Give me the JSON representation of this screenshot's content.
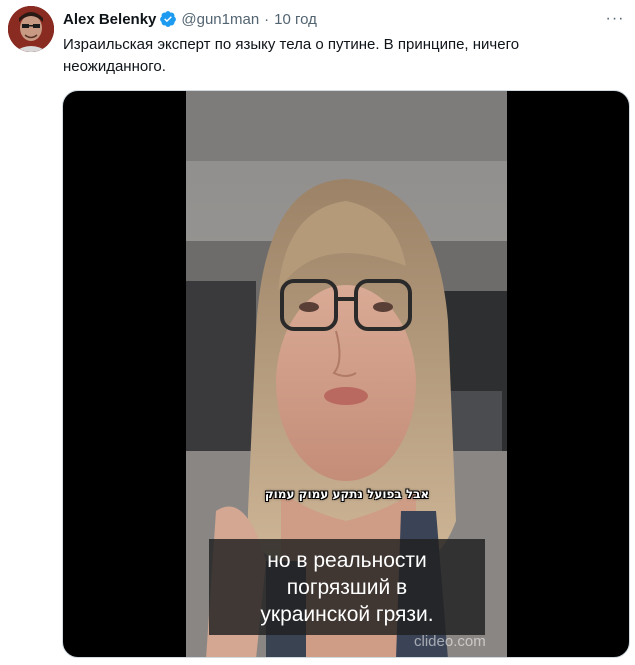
{
  "author": {
    "name": "Alex Belenky",
    "handle": "@gun1man",
    "separator": "·",
    "time": "10 год",
    "avatar_icon": "avatar-portrait",
    "verified_icon": "verified-badge-icon"
  },
  "colors": {
    "accent": "#1d9bf0",
    "text": "#0f1419",
    "muted": "#536471",
    "media_bg": "#000000"
  },
  "tweet": {
    "text": "Израильская эксперт по языку тела о путине. В принципе, ничего неожиданного."
  },
  "menu": {
    "more_label": "···"
  },
  "video": {
    "hebrew_caption": "אבל בפועל נתקע עמוק עמוק",
    "subtitle": "но в реальности\nпогрязший в\nукраинской грязи.",
    "watermark": "clideo.com"
  }
}
